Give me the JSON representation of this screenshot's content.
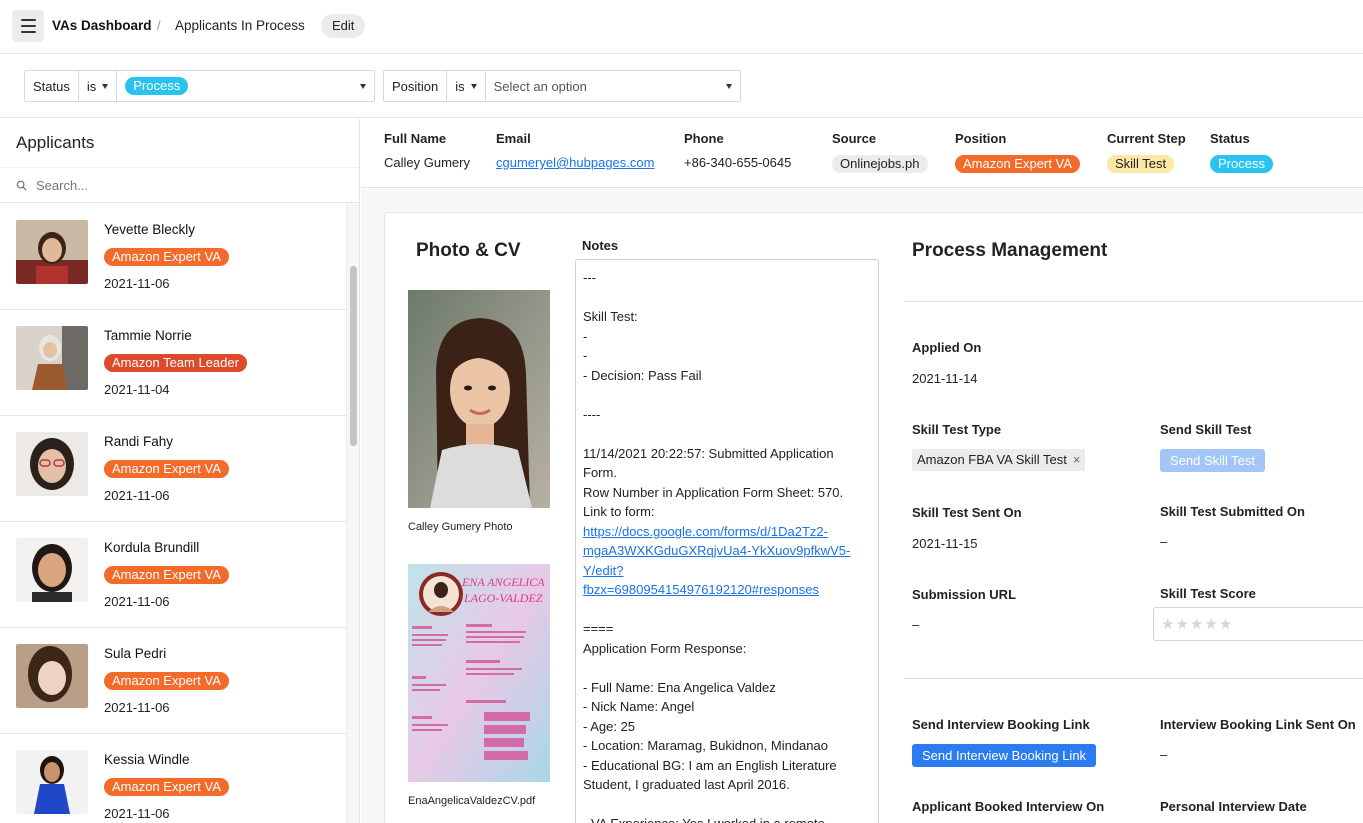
{
  "topbar": {
    "breadcrumb_root": "VAs Dashboard",
    "breadcrumb_sep": "/",
    "breadcrumb_current": "Applicants In Process",
    "edit_label": "Edit"
  },
  "filters": [
    {
      "field": "Status",
      "op": "is",
      "value": "Process",
      "value_is_chip": true
    },
    {
      "field": "Position",
      "op": "is",
      "placeholder": "Select an option"
    }
  ],
  "sidebar": {
    "title": "Applicants",
    "search_placeholder": "Search...",
    "items": [
      {
        "name": "Yevette Bleckly",
        "position": "Amazon Expert VA",
        "date": "2021-11-06"
      },
      {
        "name": "Tammie Norrie",
        "position": "Amazon Team Leader",
        "date": "2021-11-04"
      },
      {
        "name": "Randi Fahy",
        "position": "Amazon Expert VA",
        "date": "2021-11-06"
      },
      {
        "name": "Kordula Brundill",
        "position": "Amazon Expert VA",
        "date": "2021-11-06"
      },
      {
        "name": "Sula Pedri",
        "position": "Amazon Expert VA",
        "date": "2021-11-06"
      },
      {
        "name": "Kessia Windle",
        "position": "Amazon Expert VA",
        "date": "2021-11-06"
      }
    ]
  },
  "record": {
    "labels": {
      "full_name": "Full Name",
      "email": "Email",
      "phone": "Phone",
      "source": "Source",
      "position": "Position",
      "current_step": "Current Step",
      "status": "Status"
    },
    "full_name": "Calley Gumery",
    "email": "cgumeryel@hubpages.com",
    "phone": "+86-340-655-0645",
    "source": "Onlinejobs.ph",
    "position": "Amazon Expert VA",
    "current_step": "Skill Test",
    "status": "Process"
  },
  "photo_cv": {
    "title": "Photo & CV",
    "photo_caption": "Calley Gumery Photo",
    "cv_caption": "EnaAngelicaValdezCV.pdf",
    "cv_name_line1": "ENA ANGELICA",
    "cv_name_line2": "LAGO-VALDEZ"
  },
  "notes": {
    "label": "Notes",
    "lines": [
      "---",
      "",
      "Skill Test:",
      "-",
      "-",
      "- Decision: Pass Fail",
      "",
      "----",
      "",
      "11/14/2021 20:22:57: Submitted Application",
      "Form.",
      "Row Number in Application Form Sheet: 570.",
      "Link to form:",
      "https://docs.google.com/forms/d/1Da2Tz2-",
      "mgaA3WXKGduGXRqjvUa4-YkXuov9pfkwV5-",
      "Y/edit?",
      "fbzx=6980954154976192120#responses",
      "",
      "====",
      "Application Form Response:",
      "",
      "- Full Name: Ena Angelica Valdez",
      "- Nick Name: Angel",
      "- Age: 25",
      "- Location: Maramag, Bukidnon, Mindanao",
      "- Educational BG: I am an English Literature",
      "Student, I graduated last April 2016.",
      "",
      "- VA Experience: Yes I worked in a remote"
    ]
  },
  "process": {
    "title": "Process Management",
    "applied_on_label": "Applied On",
    "applied_on": "2021-11-14",
    "skill_test_type_label": "Skill Test Type",
    "skill_test_type": "Amazon FBA VA Skill Test",
    "remove_glyph": "×",
    "send_skill_test_label": "Send Skill Test",
    "send_skill_test_button": "Send Skill Test",
    "skill_test_sent_on_label": "Skill Test Sent On",
    "skill_test_sent_on": "2021-11-15",
    "skill_test_submitted_on_label": "Skill Test Submitted On",
    "skill_test_submitted_on": "–",
    "submission_url_label": "Submission URL",
    "submission_url": "–",
    "skill_test_score_label": "Skill Test Score",
    "skill_test_score": 0,
    "skill_test_score_max": 5,
    "send_interview_label": "Send Interview Booking Link",
    "send_interview_button": "Send Interview Booking Link",
    "interview_sent_on_label": "Interview Booking Link Sent On",
    "interview_sent_on": "–",
    "booked_interview_label": "Applicant Booked Interview On",
    "personal_interview_label": "Personal Interview Date"
  },
  "colors": {
    "accent_blue": "#2a7cf0",
    "status_chip": "#28c4ef",
    "position_chip": "#f26b2b",
    "team_leader_chip": "#dc4a2b",
    "step_chip": "#fde7a4"
  }
}
